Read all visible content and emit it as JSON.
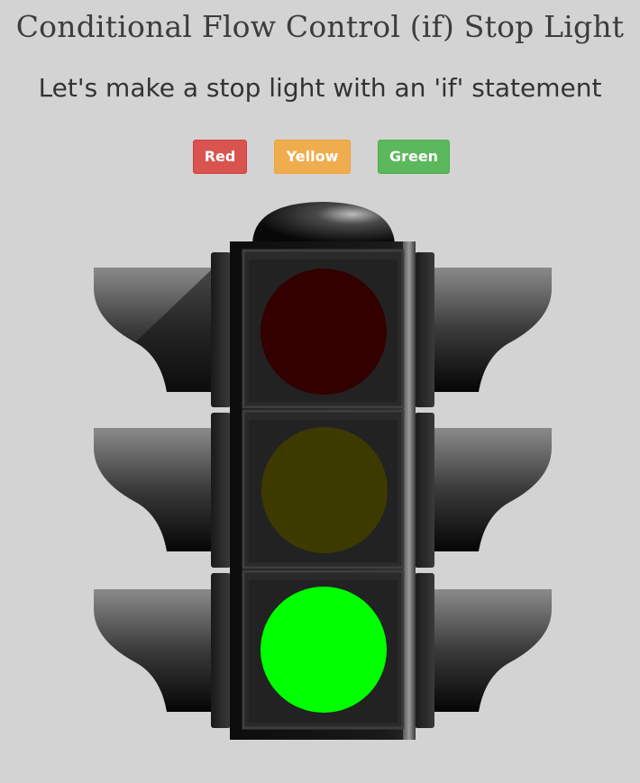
{
  "header": {
    "title": "Conditional Flow Control (if) Stop Light",
    "subtitle": "Let's make a stop light with an 'if' statement"
  },
  "controls": {
    "red_label": "Red",
    "yellow_label": "Yellow",
    "green_label": "Green"
  },
  "light": {
    "active": "green",
    "colors": {
      "red_on": "#ff0000",
      "red_off": "#330000",
      "yellow_on": "#ffd700",
      "yellow_off": "#3d3a00",
      "green_on": "#00ff00",
      "green_off": "#003300"
    },
    "button_colors": {
      "red": "#d9534f",
      "yellow": "#f0ad4e",
      "green": "#5cb85c"
    }
  }
}
